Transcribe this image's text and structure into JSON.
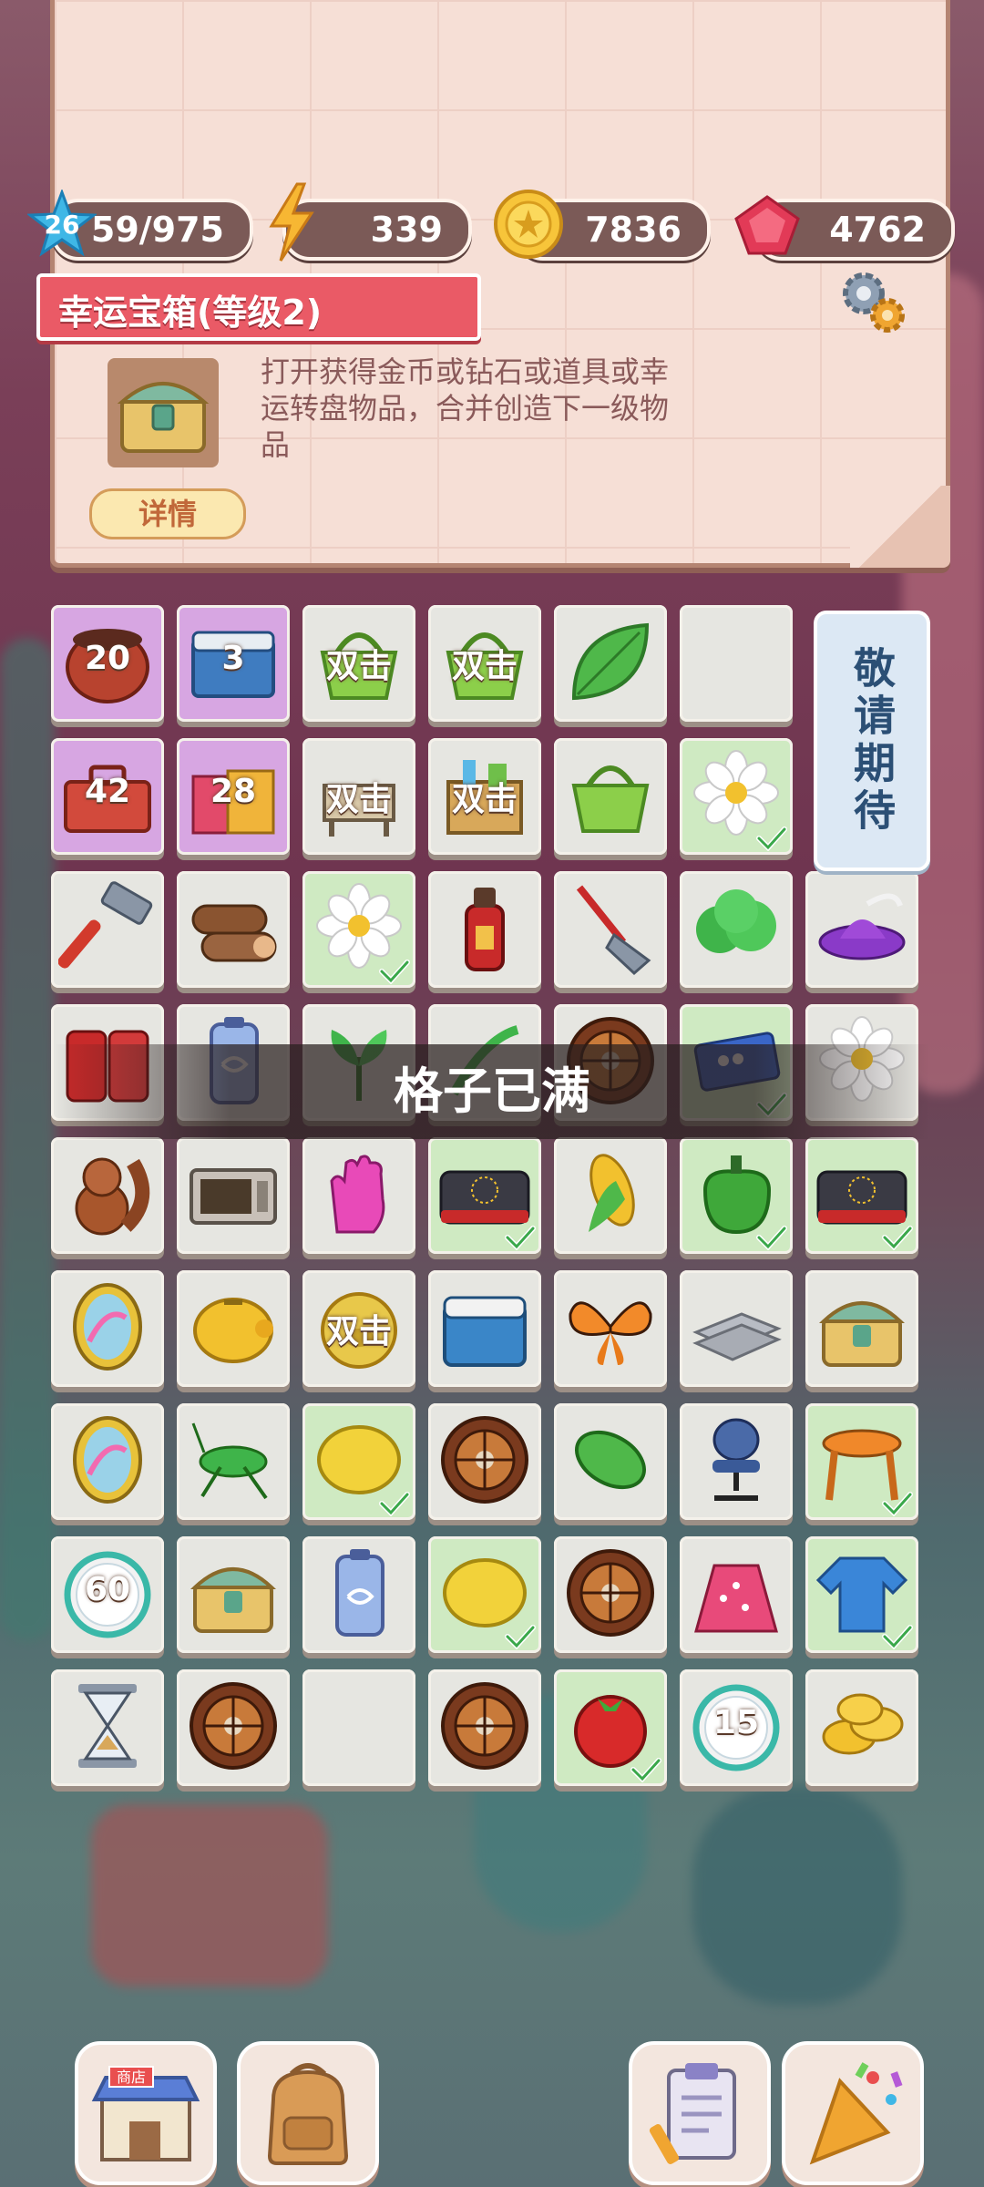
{
  "header": {
    "resources": {
      "level": "26",
      "xp": "59/975",
      "energy": "339",
      "coins": "7836",
      "gems": "4762"
    }
  },
  "info_panel": {
    "title": "幸运宝箱(等级2)",
    "description": "打开获得金币或钻石或道具或幸运转盘物品，合并创造下一级物品",
    "detail_label": "详情"
  },
  "board": {
    "rows": [
      [
        {
          "icon": "clay-pot-icon",
          "badge": "20",
          "bg": "purple"
        },
        {
          "icon": "box-icon",
          "badge": "3",
          "bg": "purple"
        },
        {
          "icon": "basket-icon",
          "badge": "双击",
          "bg": "beige"
        },
        {
          "icon": "basket-icon",
          "badge": "双击",
          "bg": "beige"
        },
        {
          "icon": "leaf-icon",
          "badge": "",
          "bg": "beige"
        },
        {
          "icon": "",
          "badge": "",
          "bg": "beige"
        }
      ],
      [
        {
          "icon": "toolbox-icon",
          "badge": "42",
          "bg": "purple"
        },
        {
          "icon": "shopping-bags-icon",
          "badge": "28",
          "bg": "purple"
        },
        {
          "icon": "stand-icon",
          "badge": "双击",
          "bg": "beige"
        },
        {
          "icon": "grocery-box-icon",
          "badge": "双击",
          "bg": "beige"
        },
        {
          "icon": "basket-icon",
          "badge": "",
          "bg": "beige"
        },
        {
          "icon": "daisy-icon",
          "badge": "",
          "bg": "green"
        }
      ],
      [
        {
          "icon": "hammer-icon",
          "badge": "",
          "bg": "beige"
        },
        {
          "icon": "logs-icon",
          "badge": "",
          "bg": "beige"
        },
        {
          "icon": "daisy-icon",
          "badge": "",
          "bg": "green"
        },
        {
          "icon": "bottle-icon",
          "badge": "",
          "bg": "beige"
        },
        {
          "icon": "shovel-icon",
          "badge": "",
          "bg": "beige"
        },
        {
          "icon": "bush-icon",
          "badge": "",
          "bg": "beige"
        },
        {
          "icon": "purple-hat-icon",
          "badge": "",
          "bg": "beige"
        }
      ],
      [
        {
          "icon": "cans-icon",
          "badge": "",
          "bg": "beige"
        },
        {
          "icon": "battery-icon",
          "badge": "",
          "bg": "beige"
        },
        {
          "icon": "plant-icon",
          "badge": "",
          "bg": "beige"
        },
        {
          "icon": "sprout-icon",
          "badge": "",
          "bg": "beige"
        },
        {
          "icon": "roulette-icon",
          "badge": "",
          "bg": "beige"
        },
        {
          "icon": "ticket-icon",
          "badge": "",
          "bg": "green"
        },
        {
          "icon": "daisy-icon",
          "badge": "",
          "bg": "beige"
        }
      ],
      [
        {
          "icon": "squirrel-icon",
          "badge": "",
          "bg": "beige"
        },
        {
          "icon": "microwave-icon",
          "badge": "",
          "bg": "beige"
        },
        {
          "icon": "glove-icon",
          "badge": "",
          "bg": "beige"
        },
        {
          "icon": "stove-icon",
          "badge": "",
          "bg": "green"
        },
        {
          "icon": "corn-icon",
          "badge": "",
          "bg": "beige"
        },
        {
          "icon": "pepper-icon",
          "badge": "",
          "bg": "green"
        },
        {
          "icon": "stove-icon",
          "badge": "",
          "bg": "green"
        }
      ],
      [
        {
          "icon": "mirror-icon",
          "badge": "",
          "bg": "beige"
        },
        {
          "icon": "piggy-bank-icon",
          "badge": "",
          "bg": "beige"
        },
        {
          "icon": "pig-icon",
          "badge": "双击",
          "bg": "beige"
        },
        {
          "icon": "cooler-icon",
          "badge": "",
          "bg": "beige"
        },
        {
          "icon": "butterfly-icon",
          "badge": "",
          "bg": "beige"
        },
        {
          "icon": "tiles-icon",
          "badge": "",
          "bg": "beige"
        },
        {
          "icon": "chest-icon",
          "badge": "",
          "bg": "beige"
        }
      ],
      [
        {
          "icon": "mirror-icon",
          "badge": "",
          "bg": "beige"
        },
        {
          "icon": "cricket-icon",
          "badge": "",
          "bg": "beige"
        },
        {
          "icon": "lemon-icon",
          "badge": "",
          "bg": "green"
        },
        {
          "icon": "roulette-icon",
          "badge": "",
          "bg": "beige"
        },
        {
          "icon": "pickle-icon",
          "badge": "",
          "bg": "beige"
        },
        {
          "icon": "chair-icon",
          "badge": "",
          "bg": "beige"
        },
        {
          "icon": "stool-icon",
          "badge": "",
          "bg": "green"
        }
      ],
      [
        {
          "icon": "timer-icon",
          "badge": "60",
          "bg": "beige"
        },
        {
          "icon": "chest-icon",
          "badge": "",
          "bg": "beige"
        },
        {
          "icon": "battery-icon",
          "badge": "",
          "bg": "beige"
        },
        {
          "icon": "lemon-icon",
          "badge": "",
          "bg": "green"
        },
        {
          "icon": "roulette-icon",
          "badge": "",
          "bg": "beige"
        },
        {
          "icon": "skirt-icon",
          "badge": "",
          "bg": "beige"
        },
        {
          "icon": "sweater-icon",
          "badge": "",
          "bg": "green"
        }
      ],
      [
        {
          "icon": "hourglass-icon",
          "badge": "",
          "bg": "beige"
        },
        {
          "icon": "roulette-icon",
          "badge": "",
          "bg": "beige"
        },
        {
          "icon": "",
          "badge": "",
          "bg": "beige"
        },
        {
          "icon": "roulette-icon",
          "badge": "",
          "bg": "beige"
        },
        {
          "icon": "tomato-icon",
          "badge": "",
          "bg": "green"
        },
        {
          "icon": "timer-icon",
          "badge": "15",
          "bg": "beige"
        },
        {
          "icon": "coins-icon",
          "badge": "",
          "bg": "beige"
        }
      ]
    ],
    "coming_soon_label": "敬请期待"
  },
  "toast": {
    "message": "格子已满"
  },
  "bottom_bar": {
    "shop_sign": "商店"
  },
  "colors": {
    "banner": "#ea5a66",
    "tile_green": "#cfeac2",
    "tile_purple": "#d7a6e2",
    "resource_pill": "#7b5a57"
  }
}
